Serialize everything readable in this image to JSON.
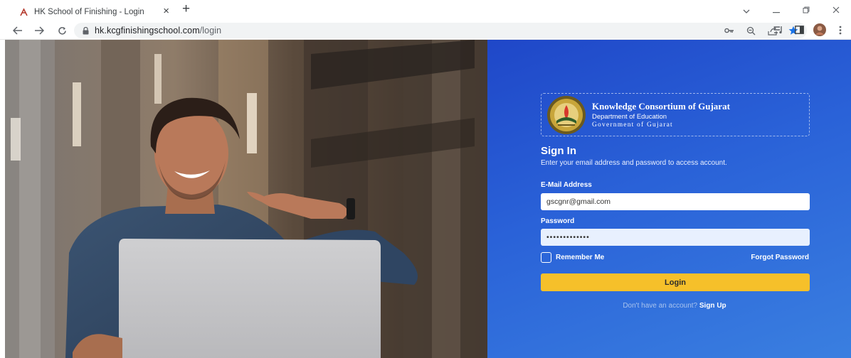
{
  "browser": {
    "tab_title": "HK School of Finishing - Login",
    "tab_close_glyph": "×",
    "new_tab_glyph": "+",
    "url_domain": "hk.kcgfinishingschool.com",
    "url_path": "/login"
  },
  "org": {
    "name": "Knowledge Consortium of Gujarat",
    "department": "Department of Education",
    "government": "Government of Gujarat"
  },
  "signin": {
    "title": "Sign In",
    "subtitle": "Enter your email address and password to access account.",
    "email_label": "E-Mail Address",
    "email_value": "gscgnr@gmail.com",
    "password_label": "Password",
    "password_value": "•••••••••••••",
    "remember_label": "Remember Me",
    "forgot_label": "Forgot Password",
    "login_label": "Login",
    "signup_prompt": "Don't have an account?",
    "signup_link": "Sign Up"
  },
  "colors": {
    "panel_blue": "#2a62d8",
    "login_button": "#f6c02a",
    "bookmark_star": "#1a73e8"
  },
  "icons": [
    "back-arrow-icon",
    "forward-arrow-icon",
    "reload-icon",
    "lock-icon",
    "key-icon",
    "zoom-icon",
    "share-icon",
    "star-icon",
    "reading-list-icon",
    "side-panel-icon",
    "profile-avatar",
    "menu-dots-icon"
  ]
}
